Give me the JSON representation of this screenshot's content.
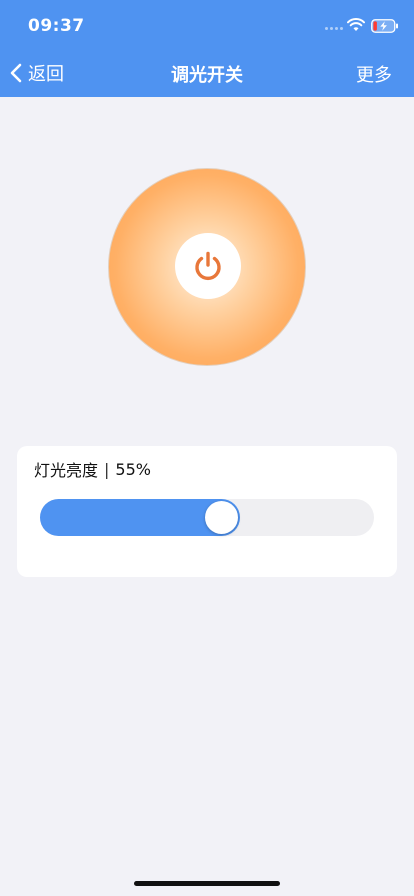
{
  "status_bar": {
    "time": "09:37",
    "battery_icon": "battery-charging-icon",
    "wifi_icon": "wifi-icon"
  },
  "nav": {
    "back_label": "返回",
    "title": "调光开关",
    "more_label": "更多",
    "back_icon": "chevron-left-icon"
  },
  "power": {
    "icon": "power-icon",
    "accent": "#e8773a"
  },
  "brightness": {
    "label": "灯光亮度",
    "separator": "|",
    "value_text": "55%",
    "level": 0.55
  },
  "colors": {
    "primary": "#4f93f1",
    "background": "#f2f2f7"
  }
}
